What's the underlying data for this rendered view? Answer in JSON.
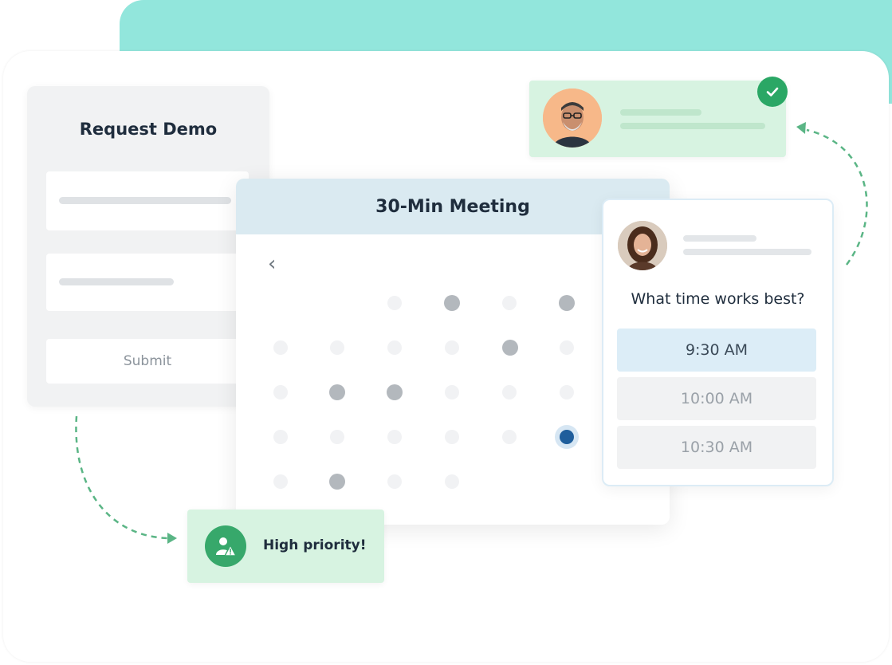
{
  "colors": {
    "teal_accent": "#92e6dc",
    "green_card": "#d7f3e1",
    "green_badge": "#2aa765",
    "calendar_header": "#daeaf1",
    "selected_day": "#1f5e9c",
    "selected_slot": "#dcedf7"
  },
  "form": {
    "title": "Request Demo",
    "submit_label": "Submit"
  },
  "calendar": {
    "title": "30-Min Meeting",
    "back_icon": "chevron-left-icon",
    "back_glyph": "‹"
  },
  "scheduler": {
    "question": "What time works best?",
    "slots": [
      {
        "label": "9:30 AM",
        "selected": true
      },
      {
        "label": "10:00 AM",
        "selected": false
      },
      {
        "label": "10:30 AM",
        "selected": false
      }
    ]
  },
  "profile_notification": {
    "confirmed_icon": "check-icon"
  },
  "priority_alert": {
    "label": "High priority!",
    "icon": "priority-user-icon"
  }
}
